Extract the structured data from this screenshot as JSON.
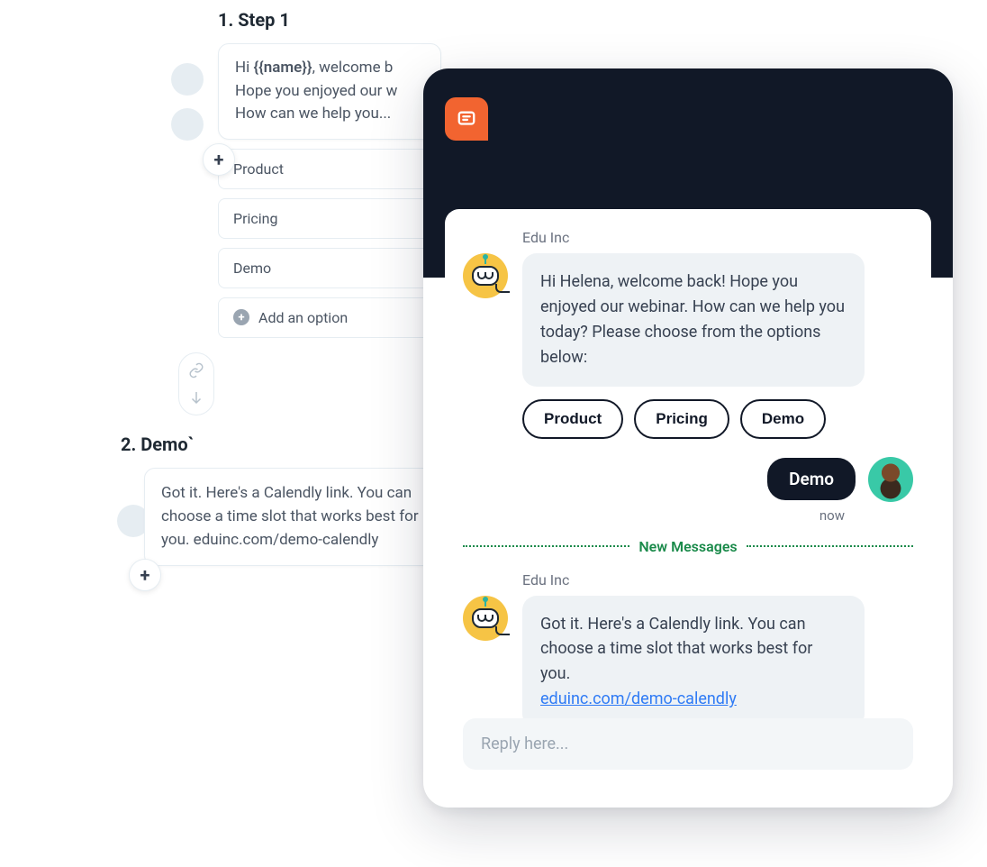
{
  "flow": {
    "step1_heading": "1.  Step 1",
    "step1_text_pre": "Hi ",
    "step1_template": "{{name}}",
    "step1_text_post": ", welcome b\nHope you enjoyed our w\nHow can we help you...",
    "options": [
      "Product",
      "Pricing",
      "Demo"
    ],
    "add_option": "Add an option",
    "step2_heading": "2. Demo`",
    "step2_text": "Got it. Here's a Calendly link. You can choose a time slot that works best for you. eduinc.com/demo-calendly"
  },
  "chat": {
    "sender": "Edu Inc",
    "bot_message_1": "Hi Helena, welcome back! Hope you enjoyed our webinar. How can we help you today? Please choose from the options below:",
    "chips": [
      "Product",
      "Pricing",
      "Demo"
    ],
    "user_choice": "Demo",
    "timestamp": "now",
    "divider": "New Messages",
    "bot_message_2_text": "Got it. Here's a Calendly link. You can choose a time slot that works best for you.",
    "bot_message_2_link": "eduinc.com/demo-calendly",
    "reply_placeholder": "Reply here..."
  }
}
